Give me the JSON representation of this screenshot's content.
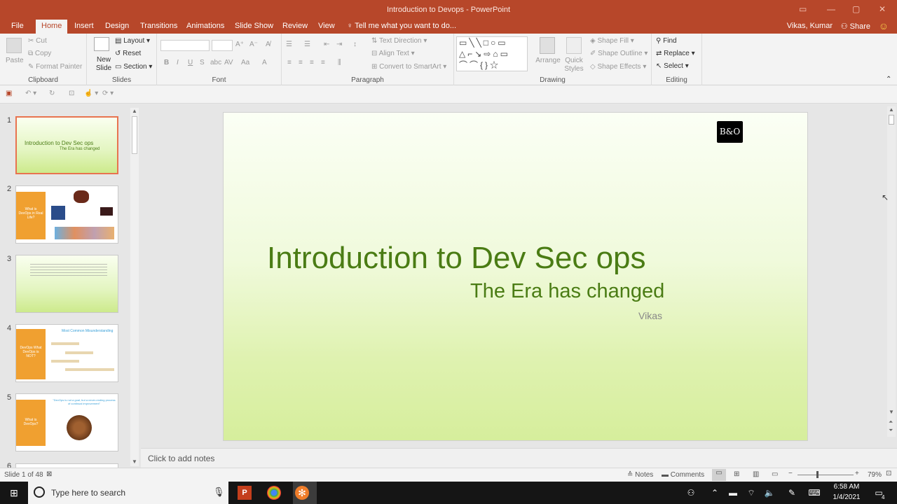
{
  "window": {
    "title": "Introduction to Devops  -  PowerPoint"
  },
  "tabs": [
    "File",
    "Home",
    "Insert",
    "Design",
    "Transitions",
    "Animations",
    "Slide Show",
    "Review",
    "View"
  ],
  "tell_me": "Tell me what you want to do...",
  "account": {
    "name": "Vikas, Kumar",
    "share": "Share"
  },
  "ribbon": {
    "clipboard": {
      "label": "Clipboard",
      "paste": "Paste",
      "cut": "Cut",
      "copy": "Copy",
      "format_painter": "Format Painter"
    },
    "slides": {
      "label": "Slides",
      "new_slide": "New Slide",
      "layout": "Layout",
      "reset": "Reset",
      "section": "Section"
    },
    "font": {
      "label": "Font"
    },
    "paragraph": {
      "label": "Paragraph",
      "text_direction": "Text Direction",
      "align_text": "Align Text",
      "convert": "Convert to SmartArt"
    },
    "drawing": {
      "label": "Drawing",
      "arrange": "Arrange",
      "quick_styles": "Quick Styles",
      "shape_fill": "Shape Fill",
      "shape_outline": "Shape Outline",
      "shape_effects": "Shape Effects"
    },
    "editing": {
      "label": "Editing",
      "find": "Find",
      "replace": "Replace",
      "select": "Select"
    }
  },
  "thumbnails": {
    "numbers": [
      "1",
      "2",
      "3",
      "4",
      "5",
      "6"
    ],
    "t1": {
      "title": "Introduction to Dev Sec ops",
      "sub": "The Era has changed"
    },
    "t2": {
      "box": "What is DevOps in Real Life?"
    },
    "t4": {
      "box": "DevOps What DevOps is NOT?",
      "heading": "Most Common Misunderstanding"
    },
    "t5": {
      "box": "What is DevOps?",
      "heading": "\"DevOps is not a goal, but a never-ending process of continual improvement\""
    }
  },
  "slide": {
    "title": "Introduction to Dev Sec ops",
    "subtitle": "The Era has changed",
    "author": "Vikas",
    "logo": "B&O"
  },
  "notes_placeholder": "Click to add notes",
  "status": {
    "slide_count": "Slide 1 of 48",
    "notes": "Notes",
    "comments": "Comments",
    "zoom": "79%"
  },
  "taskbar": {
    "search": "Type here to search",
    "time": "6:58 AM",
    "date": "1/4/2021",
    "notifications": "4"
  }
}
